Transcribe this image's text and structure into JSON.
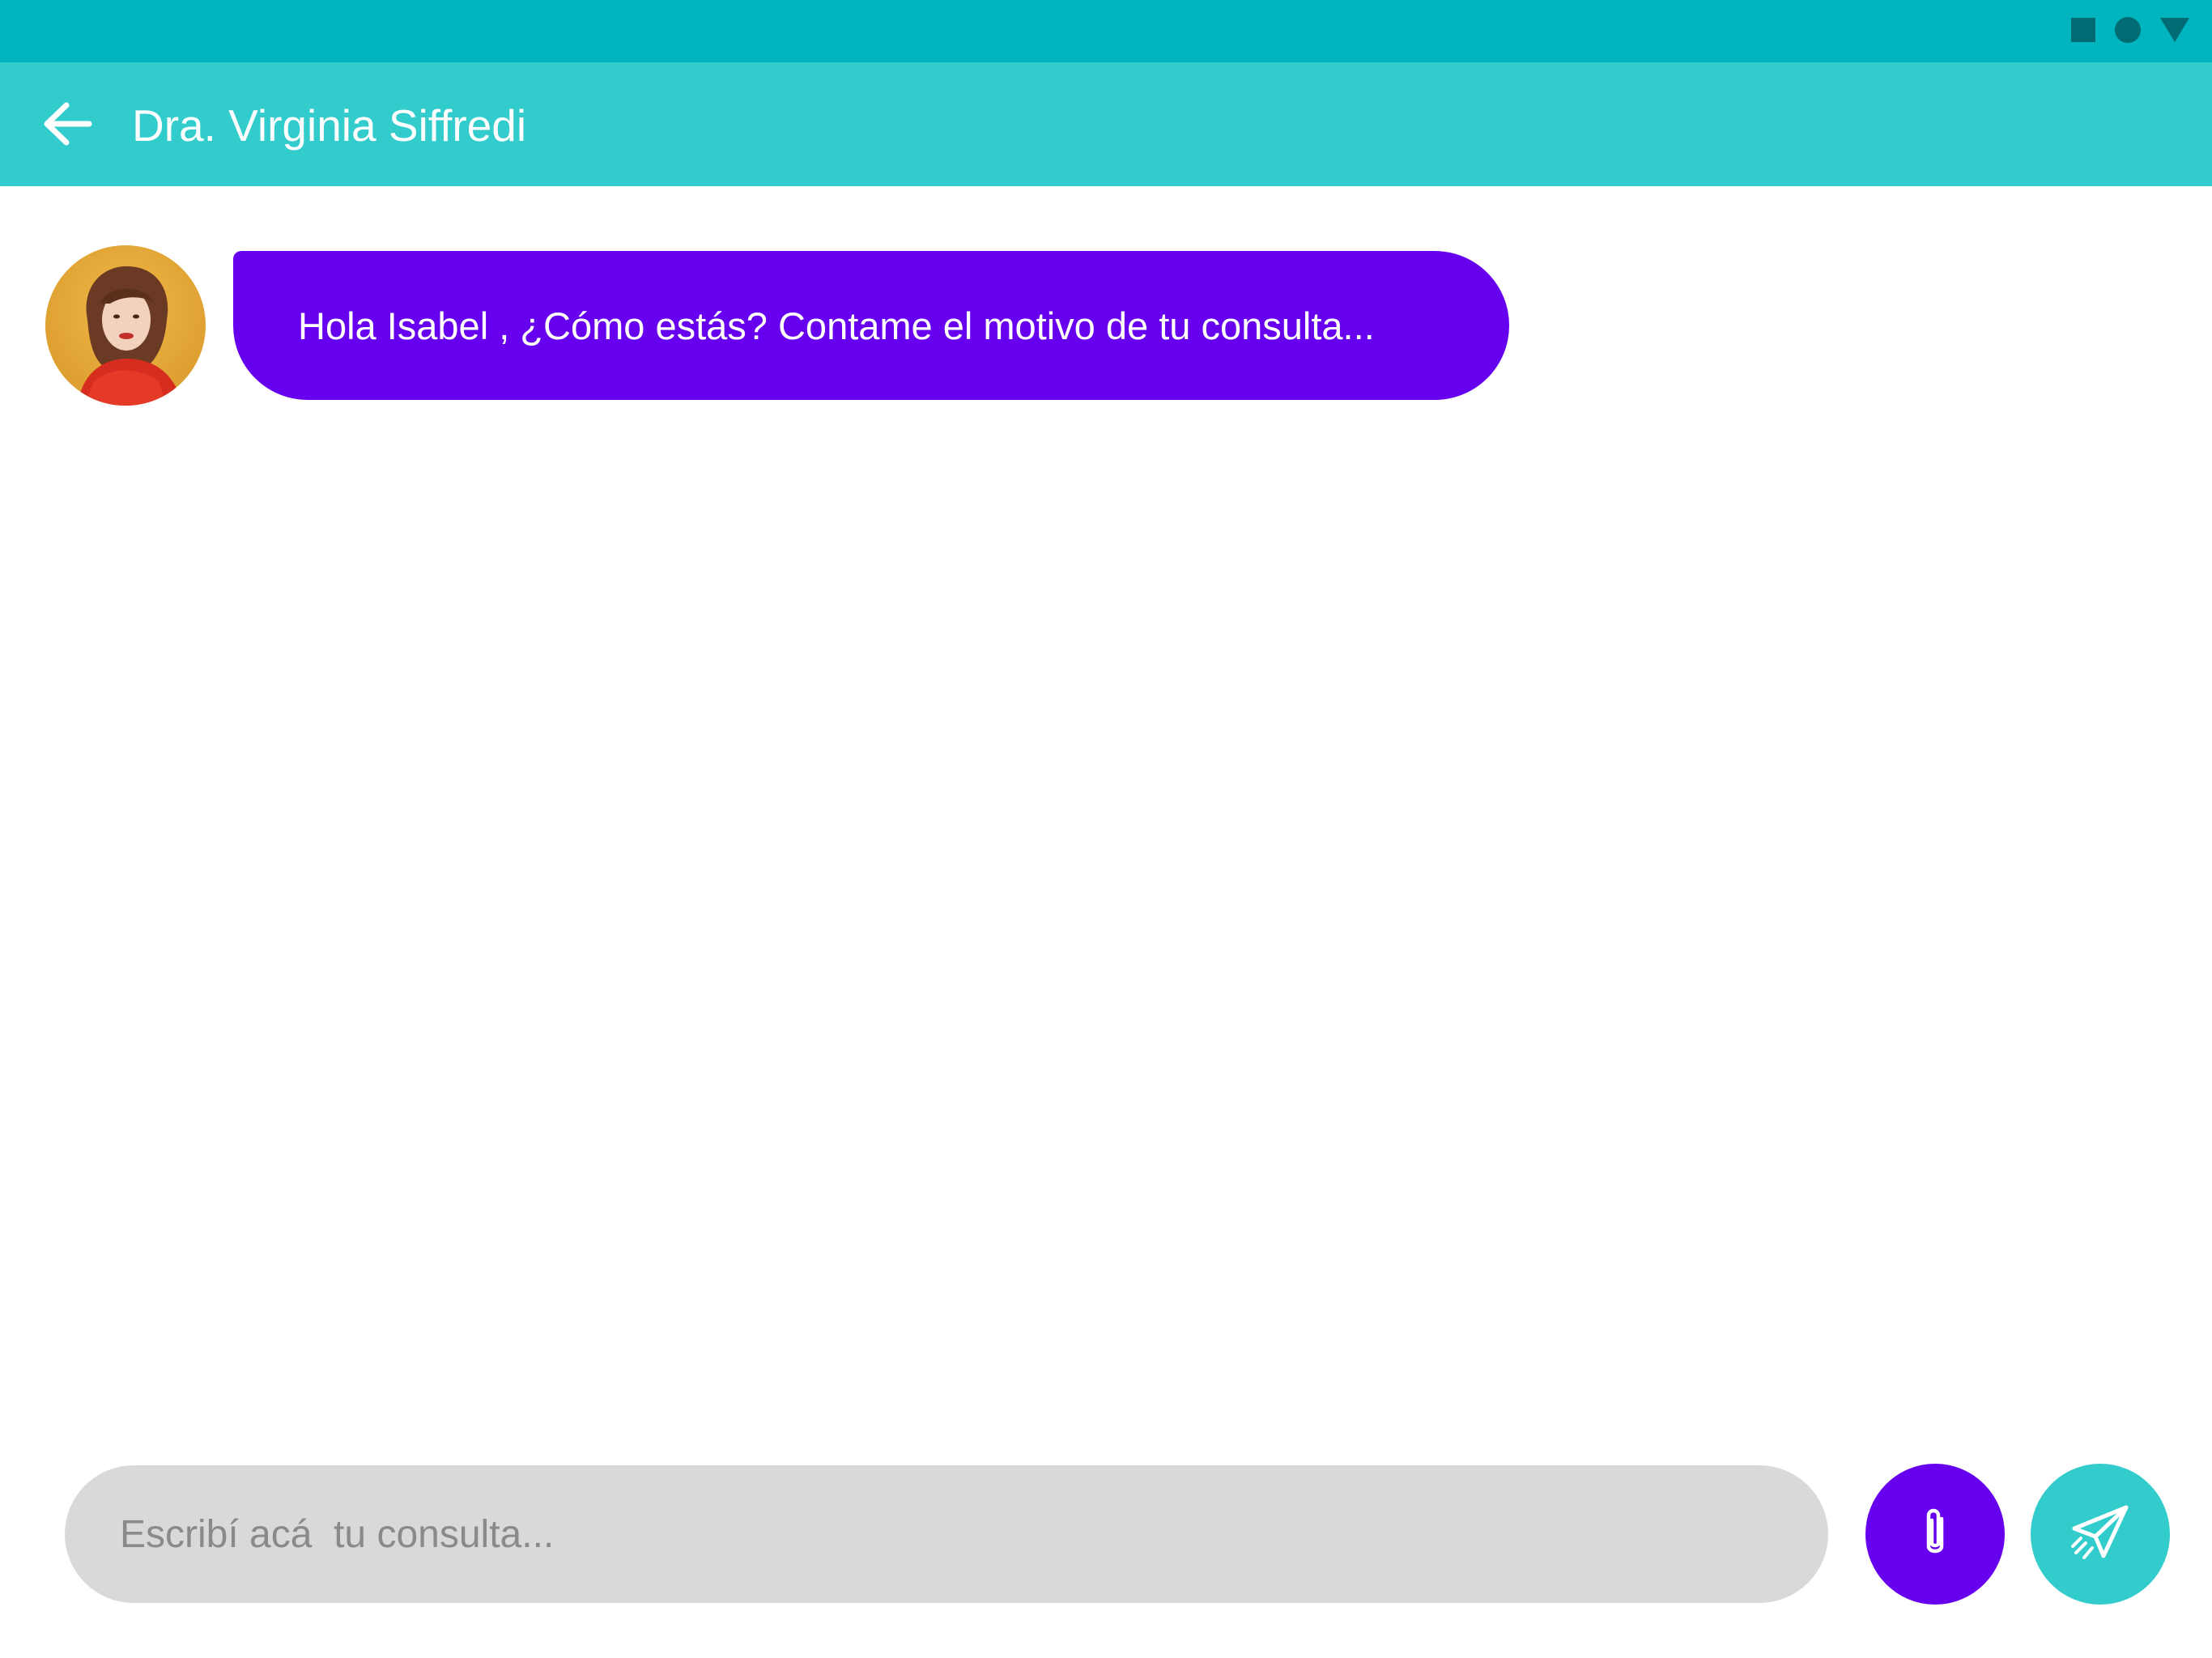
{
  "colors": {
    "status_bar": "#00b4c0",
    "app_bar": "#33cccc",
    "bubble": "#6600ee",
    "input_bg": "#d9d9d9",
    "attach_button": "#6600ee",
    "send_button": "#33cccc"
  },
  "status_bar": {
    "icons": [
      "square-icon",
      "circle-icon",
      "triangle-icon"
    ]
  },
  "header": {
    "back_icon": "arrow-left-icon",
    "title": "Dra. Virginia Siffredi"
  },
  "conversation": {
    "messages": [
      {
        "sender_avatar": "doctor-avatar",
        "text": "Hola Isabel , ¿Cómo estás? Contame el motivo de tu consulta..."
      }
    ]
  },
  "composer": {
    "value": "",
    "placeholder": "Escribí acá  tu consulta...",
    "attach_icon": "paperclip-icon",
    "send_icon": "paper-plane-icon"
  }
}
